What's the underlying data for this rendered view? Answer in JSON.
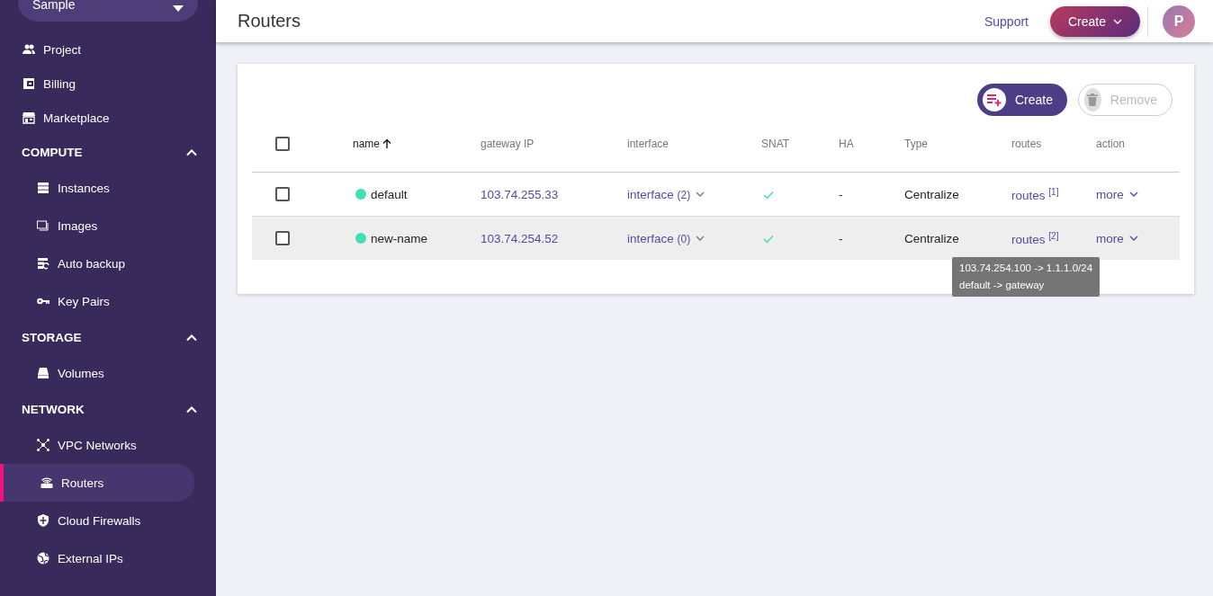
{
  "sidebar": {
    "project_select": "Sample",
    "items": [
      {
        "label": "Project",
        "selected": false
      },
      {
        "label": "Billing",
        "selected": false
      },
      {
        "label": "Marketplace",
        "selected": false
      }
    ],
    "sections": [
      {
        "title": "COMPUTE",
        "expanded": true,
        "items": [
          {
            "label": "Instances",
            "selected": false
          },
          {
            "label": "Images",
            "selected": false
          },
          {
            "label": "Auto backup",
            "selected": false
          },
          {
            "label": "Key Pairs",
            "selected": false
          }
        ]
      },
      {
        "title": "STORAGE",
        "expanded": true,
        "items": [
          {
            "label": "Volumes",
            "selected": false
          }
        ]
      },
      {
        "title": "NETWORK",
        "expanded": true,
        "items": [
          {
            "label": "VPC Networks",
            "selected": false
          },
          {
            "label": "Routers",
            "selected": true
          },
          {
            "label": "Cloud Firewalls",
            "selected": false
          },
          {
            "label": "External IPs",
            "selected": false
          }
        ]
      }
    ]
  },
  "header": {
    "title": "Routers",
    "support": "Support",
    "create": "Create",
    "avatar": "P"
  },
  "toolbar": {
    "create": {
      "label": "Create",
      "disabled": false
    },
    "remove": {
      "label": "Remove",
      "disabled": true
    }
  },
  "table": {
    "select_all": false,
    "columns": [
      {
        "label": "name",
        "sorted": true
      },
      {
        "label": "gateway IP",
        "sorted": false
      },
      {
        "label": "interface",
        "sorted": false
      },
      {
        "label": "SNAT",
        "sorted": false
      },
      {
        "label": "HA",
        "sorted": false
      },
      {
        "label": "Type",
        "sorted": false
      },
      {
        "label": "routes",
        "sorted": false
      },
      {
        "label": "action",
        "sorted": false
      }
    ],
    "rows": [
      {
        "selected": false,
        "highlighted": false,
        "color": "#40e0b5",
        "name": "default",
        "gateway": "103.74.255.33",
        "interface": "interface",
        "interface_count": "(2)",
        "snat": true,
        "ha": "-",
        "type": "Centralize",
        "routes": "routes",
        "routes_count": "[1]",
        "action": "more"
      },
      {
        "selected": false,
        "highlighted": true,
        "color": "#40e0b5",
        "name": "new-name",
        "gateway": "103.74.254.52",
        "interface": "interface",
        "interface_count": "(0)",
        "snat": true,
        "ha": "-",
        "type": "Centralize",
        "routes": "routes",
        "routes_count": "[2]",
        "action": "more",
        "tooltip": [
          "103.74.254.100 -> 1.1.1.0/24",
          "default -> gateway"
        ]
      }
    ]
  }
}
